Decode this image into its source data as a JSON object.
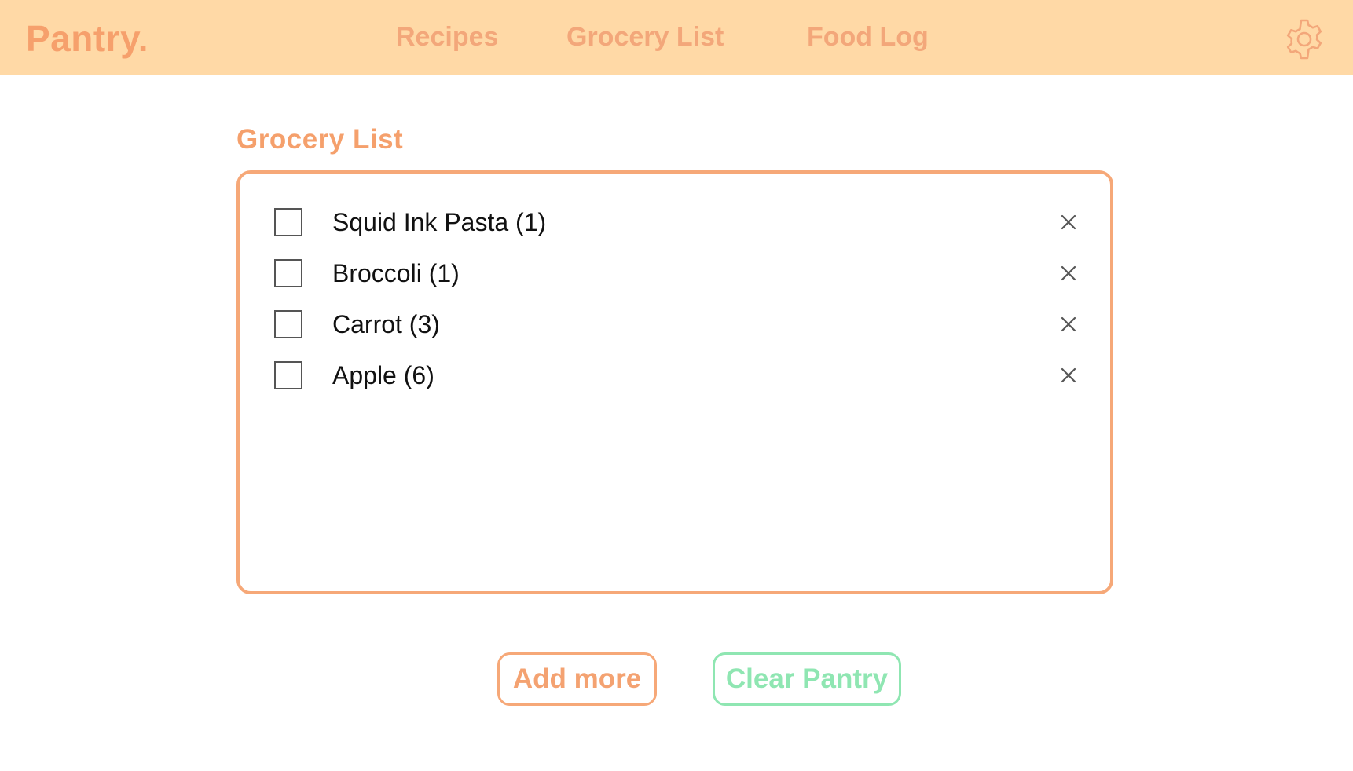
{
  "app": {
    "logo": "Pantry."
  },
  "nav": {
    "items": [
      {
        "label": "Recipes"
      },
      {
        "label": "Grocery List"
      },
      {
        "label": "Food Log"
      }
    ],
    "settings_icon": "gear-icon"
  },
  "main": {
    "title": "Grocery List",
    "items": [
      {
        "label": "Squid Ink Pasta (1)",
        "checked": false
      },
      {
        "label": "Broccoli (1)",
        "checked": false
      },
      {
        "label": "Carrot (3)",
        "checked": false
      },
      {
        "label": "Apple (6)",
        "checked": false
      }
    ],
    "remove_icon": "close-icon"
  },
  "actions": {
    "add_label": "Add more",
    "clear_label": "Clear Pantry"
  },
  "colors": {
    "header_bg": "#FFD9A6",
    "accent_orange": "#F6A878",
    "accent_green": "#8FE6B2"
  }
}
